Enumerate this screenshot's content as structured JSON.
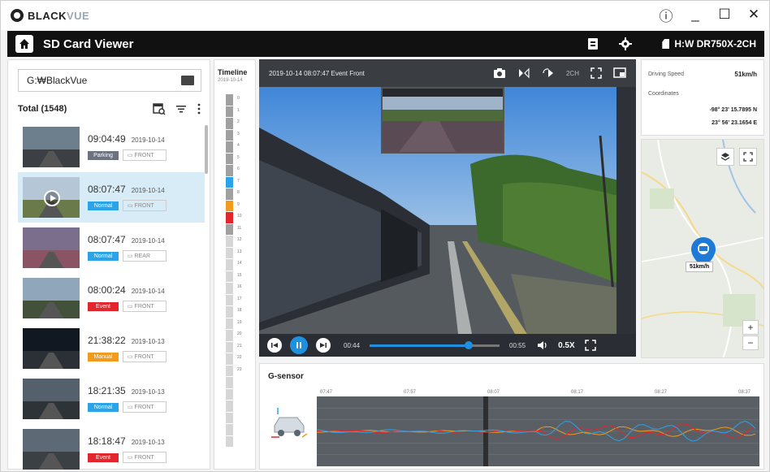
{
  "window": {
    "brand_prefix": "BLACK",
    "brand_suffix": "VUE",
    "controls": [
      "ⓘ",
      "_",
      "☐",
      "✕"
    ]
  },
  "appbar": {
    "title": "SD Card Viewer",
    "device": "H:W DR750X-2CH"
  },
  "left": {
    "folder_path": "G:₩BlackVue",
    "total": "Total (1548)"
  },
  "recordings": [
    {
      "time": "09:04:49",
      "date": "2019-10-14",
      "tag": "Parking",
      "tag_color": "#6b7280",
      "channel": "FRONT",
      "sky": "#6d7f8d",
      "ground": "#3c3f44"
    },
    {
      "time": "08:07:47",
      "date": "2019-10-14",
      "tag": "Normal",
      "tag_color": "#2aa3e8",
      "channel": "FRONT",
      "sky": "#b5c6d6",
      "ground": "#6a7a4a"
    },
    {
      "time": "08:07:47",
      "date": "2019-10-14",
      "tag": "Normal",
      "tag_color": "#2aa3e8",
      "channel": "REAR",
      "sky": "#7b6d8c",
      "ground": "#8a5464"
    },
    {
      "time": "08:00:24",
      "date": "2019-10-14",
      "tag": "Event",
      "tag_color": "#e3262e",
      "channel": "FRONT",
      "sky": "#8fa6bb",
      "ground": "#44513a"
    },
    {
      "time": "21:38:22",
      "date": "2019-10-13",
      "tag": "Manual",
      "tag_color": "#f29a1c",
      "channel": "FRONT",
      "sky": "#121822",
      "ground": "#2a3036"
    },
    {
      "time": "18:21:35",
      "date": "2019-10-13",
      "tag": "Normal",
      "tag_color": "#2aa3e8",
      "channel": "FRONT",
      "sky": "#55606d",
      "ground": "#2e3338"
    },
    {
      "time": "18:18:47",
      "date": "2019-10-13",
      "tag": "Event",
      "tag_color": "#e3262e",
      "channel": "FRONT",
      "sky": "#5d6a75",
      "ground": "#3b4045"
    }
  ],
  "timeline": {
    "title": "Timeline",
    "date": "2019-10-14",
    "segments": [
      "#a0a0a0",
      "#a0a0a0",
      "#a0a0a0",
      "#a0a0a0",
      "#a0a0a0",
      "#a0a0a0",
      "#a0a0a0",
      "#2aa3e8",
      "#a0a0a0",
      "#f29a1c",
      "#e3262e",
      "#a0a0a0",
      "#d6d6d6",
      "#d6d6d6",
      "#d6d6d6",
      "#d6d6d6",
      "#d6d6d6",
      "#d6d6d6",
      "#d6d6d6",
      "#d6d6d6",
      "#d6d6d6",
      "#d6d6d6",
      "#d6d6d6",
      "#d6d6d6",
      "#d6d6d6",
      "#d6d6d6",
      "#d6d6d6",
      "#d6d6d6",
      "#d6d6d6",
      "#d6d6d6"
    ],
    "hours": [
      "0",
      "1",
      "2",
      "3",
      "4",
      "5",
      "6",
      "7",
      "8",
      "9",
      "10",
      "11",
      "12",
      "13",
      "14",
      "15",
      "16",
      "17",
      "18",
      "19",
      "20",
      "21",
      "22",
      "23"
    ]
  },
  "video": {
    "caption": "2019-10-14 08:07:47 Event Front",
    "current_time": "00:44",
    "total_time": "00:55",
    "progress": 0.76,
    "speed": "0.5X",
    "channel_label": "2CH"
  },
  "info": {
    "speed_label": "Driving Speed",
    "speed_value": "51km/h",
    "coords_label": "Coordinates",
    "lat": "-98° 23' 15.7895 N",
    "lon": "23° 56' 23.1654 E"
  },
  "map": {
    "pin_label": "51km/h",
    "zoom_in": "+",
    "zoom_out": "−"
  },
  "gsensor": {
    "title": "G-sensor",
    "ticks": [
      "07:47",
      "07:57",
      "08:07",
      "08:17",
      "08:27",
      "08:37"
    ]
  }
}
